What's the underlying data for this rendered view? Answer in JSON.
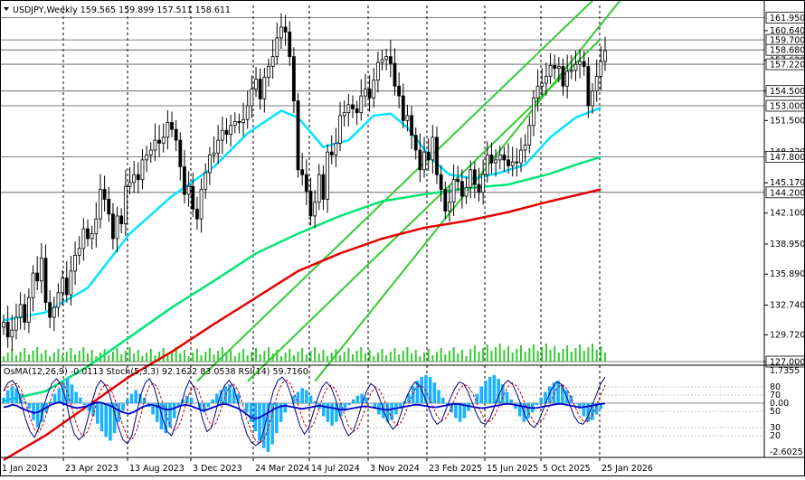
{
  "header": {
    "symbol_line": "USDJPY,Weekly  159.565 159.899 157.511 158.611"
  },
  "colors": {
    "candle": "#000000",
    "ma_fast": "#00e5ff",
    "ma_mid": "#00e676",
    "ma_slow": "#e60000",
    "channel": "#33cc33",
    "hist": "#1ab2ff",
    "stoch_main": "#000080",
    "stoch_signal": "#cc0000",
    "rsi": "#0000cc",
    "grid": "#000000"
  },
  "chart_data": [
    {
      "type": "candlestick",
      "title": "USDJPY,Weekly",
      "ohlc_last": {
        "open": 159.565,
        "high": 159.899,
        "low": 157.511,
        "close": 158.611
      },
      "ylim": [
        127.0,
        163.2
      ],
      "y_ticks": [
        160.64,
        157.62,
        154.5,
        151.5,
        148.32,
        145.17,
        142.1,
        138.95,
        135.89,
        132.74,
        129.72,
        127.0
      ],
      "x_ticks": [
        "1 Jan 2023",
        "23 Apr 2023",
        "13 Aug 2023",
        "3 Dec 2023",
        "24 Mar 2024",
        "14 Jul 2024",
        "3 Nov 2024",
        "23 Feb 2025",
        "15 Jun 2025",
        "5 Oct 2025",
        "25 Jan 2026"
      ],
      "price_levels": [
        {
          "value": 161.95,
          "label": "161.950"
        },
        {
          "value": 159.7,
          "label": "159.700"
        },
        {
          "value": 158.68,
          "label": "158.680"
        },
        {
          "value": 157.22,
          "label": "157.220"
        },
        {
          "value": 154.5,
          "label": "154.500"
        },
        {
          "value": 153.0,
          "label": "153.000"
        },
        {
          "value": 147.8,
          "label": "147.800"
        },
        {
          "value": 144.2,
          "label": "144.200"
        },
        {
          "value": 127.0,
          "label": "127.000"
        }
      ],
      "candles_close": [
        131.0,
        129.5,
        130.2,
        131.5,
        132.8,
        131.0,
        133.5,
        136.0,
        135.2,
        137.5,
        133.0,
        131.5,
        132.5,
        134.0,
        135.5,
        133.8,
        136.2,
        137.8,
        138.5,
        140.5,
        139.5,
        140.0,
        141.5,
        144.5,
        143.5,
        142.0,
        139.5,
        141.8,
        141.0,
        144.8,
        145.2,
        146.0,
        145.5,
        147.5,
        148.0,
        148.5,
        149.5,
        149.2,
        149.8,
        151.3,
        150.6,
        149.5,
        146.8,
        144.0,
        144.8,
        142.5,
        141.5,
        144.5,
        146.2,
        148.0,
        148.2,
        149.5,
        150.5,
        150.1,
        151.0,
        151.4,
        151.3,
        151.6,
        153.0,
        154.7,
        155.7,
        153.7,
        155.9,
        157.0,
        158.0,
        159.9,
        161.0,
        160.5,
        158.0,
        153.5,
        146.5,
        146.0,
        144.3,
        141.8,
        143.2,
        146.0,
        143.5,
        148.3,
        148.0,
        149.2,
        152.0,
        152.3,
        153.1,
        152.7,
        152.3,
        154.0,
        154.7,
        153.8,
        155.6,
        157.4,
        157.7,
        158.0,
        157.3,
        155.0,
        154.0,
        151.5,
        152.0,
        150.0,
        148.5,
        146.5,
        148.3,
        147.5,
        149.8,
        146.0,
        144.5,
        142.3,
        143.2,
        145.5,
        145.3,
        143.8,
        144.7,
        146.5,
        145.0,
        144.2,
        146.0,
        148.0,
        147.2,
        147.5,
        148.0,
        147.5,
        146.9,
        147.3,
        147.2,
        148.5,
        149.0,
        151.0,
        153.8,
        155.0,
        155.3,
        156.0,
        157.1,
        156.8,
        157.0,
        155.0,
        156.5,
        156.6,
        157.2,
        157.5,
        157.0,
        153.0,
        154.5,
        156.0,
        157.5,
        158.6
      ],
      "ma_fast": {
        "label": "",
        "points": [
          [
            0,
            131.2
          ],
          [
            10,
            132.0
          ],
          [
            20,
            134.5
          ],
          [
            30,
            140.0
          ],
          [
            40,
            143.8
          ],
          [
            50,
            146.8
          ],
          [
            58,
            150.2
          ],
          [
            66,
            152.5
          ],
          [
            70,
            151.8
          ],
          [
            76,
            148.8
          ],
          [
            82,
            149.5
          ],
          [
            88,
            152.0
          ],
          [
            92,
            152.2
          ],
          [
            96,
            150.8
          ],
          [
            102,
            147.5
          ],
          [
            106,
            146.0
          ],
          [
            112,
            145.6
          ],
          [
            118,
            146.2
          ],
          [
            124,
            147.0
          ],
          [
            130,
            149.8
          ],
          [
            136,
            151.8
          ],
          [
            142,
            152.8
          ]
        ]
      },
      "ma_mid": {
        "label": "",
        "points": [
          [
            0,
            123.0
          ],
          [
            10,
            124.0
          ],
          [
            20,
            126.5
          ],
          [
            30,
            129.5
          ],
          [
            40,
            132.5
          ],
          [
            50,
            135.2
          ],
          [
            60,
            138.0
          ],
          [
            70,
            140.0
          ],
          [
            80,
            141.8
          ],
          [
            90,
            143.3
          ],
          [
            100,
            144.0
          ],
          [
            110,
            144.6
          ],
          [
            120,
            145.0
          ],
          [
            130,
            146.1
          ],
          [
            136,
            147.0
          ],
          [
            142,
            147.8
          ]
        ]
      },
      "ma_slow": {
        "label": "",
        "points": [
          [
            0,
            117.0
          ],
          [
            10,
            119.5
          ],
          [
            20,
            122.5
          ],
          [
            30,
            125.5
          ],
          [
            40,
            128.0
          ],
          [
            50,
            130.8
          ],
          [
            60,
            133.5
          ],
          [
            70,
            136.2
          ],
          [
            80,
            138.0
          ],
          [
            90,
            139.5
          ],
          [
            100,
            140.6
          ],
          [
            110,
            141.3
          ],
          [
            120,
            142.2
          ],
          [
            130,
            143.3
          ],
          [
            136,
            143.9
          ],
          [
            142,
            144.5
          ]
        ]
      },
      "channel_lines": [
        {
          "points": [
            [
              46,
              125.0
            ],
            [
              142,
              164.5
            ]
          ]
        },
        {
          "points": [
            [
              58,
              125.0
            ],
            [
              142,
              159.8
            ]
          ]
        },
        {
          "points": [
            [
              74,
              125.0
            ],
            [
              149,
              165.0
            ]
          ]
        }
      ]
    },
    {
      "type": "oscillator",
      "title": "OsMA(12,26,9) -0.0113  Stoch(5,3,3) 92.1622 83.0538  RSI(14) 59.7160",
      "y_labels": [
        "1.7355",
        "80",
        "70",
        "0.00",
        "50",
        "30",
        "20",
        "-2.6025"
      ],
      "osma": [
        0.3,
        0.7,
        0.9,
        0.8,
        0.5,
        0.1,
        -0.3,
        -0.9,
        -1.3,
        -1.0,
        -0.5,
        0.1,
        0.5,
        0.8,
        1.1,
        1.3,
        1.0,
        0.6,
        0.3,
        -0.1,
        -0.4,
        -0.7,
        -1.1,
        -1.5,
        -1.8,
        -2.0,
        -1.6,
        -1.0,
        -0.4,
        0.2,
        0.5,
        0.7,
        0.5,
        0.3,
        -0.2,
        -0.6,
        -1.0,
        -1.4,
        -1.6,
        -1.3,
        -0.8,
        -0.2,
        0.2,
        0.4,
        0.3,
        0.0,
        -0.3,
        -0.5,
        -0.2,
        0.2,
        0.5,
        0.7,
        0.9,
        1.0,
        0.8,
        0.5,
        0.0,
        -0.5,
        -1.0,
        -1.5,
        -2.0,
        -2.4,
        -2.6,
        -2.2,
        -1.6,
        -1.0,
        -0.5,
        0.0,
        0.4,
        0.6,
        0.8,
        0.7,
        0.4,
        0.1,
        -0.3,
        -0.7,
        -1.0,
        -1.2,
        -1.0,
        -0.7,
        -0.4,
        -0.1,
        0.2,
        0.4,
        0.5,
        0.3,
        0.0,
        -0.3,
        -0.6,
        -0.8,
        -1.0,
        -0.9,
        -0.6,
        -0.3,
        0.1,
        0.5,
        0.9,
        1.2,
        1.4,
        1.5,
        1.4,
        1.1,
        0.7,
        0.3,
        -0.1,
        -0.5,
        -0.8,
        -1.0,
        -0.8,
        -0.4,
        0.0,
        0.5,
        0.9,
        1.2,
        1.4,
        1.5,
        1.3,
        1.0,
        0.6,
        0.2,
        -0.3,
        -0.7,
        -1.0,
        -0.8,
        -0.5,
        -0.1,
        0.3,
        0.6,
        0.9,
        1.1,
        1.2,
        1.0,
        0.7,
        0.4,
        0.0,
        -0.3,
        -0.7,
        -1.0,
        -0.9,
        -0.6,
        -0.3,
        -0.01
      ],
      "stoch_main": [
        75,
        85,
        88,
        80,
        60,
        40,
        25,
        18,
        30,
        55,
        72,
        85,
        90,
        82,
        66,
        40,
        22,
        15,
        20,
        40,
        62,
        80,
        88,
        82,
        70,
        50,
        30,
        15,
        10,
        20,
        45,
        70,
        85,
        90,
        80,
        60,
        40,
        25,
        20,
        35,
        55,
        75,
        88,
        80,
        62,
        40,
        25,
        30,
        50,
        70,
        82,
        88,
        80,
        60,
        40,
        22,
        12,
        8,
        12,
        30,
        55,
        75,
        88,
        92,
        85,
        70,
        50,
        32,
        22,
        30,
        48,
        66,
        80,
        86,
        80,
        66,
        46,
        30,
        20,
        25,
        40,
        58,
        74,
        84,
        80,
        66,
        50,
        36,
        28,
        34,
        50,
        66,
        78,
        86,
        82,
        70,
        56,
        42,
        34,
        38,
        52,
        66,
        78,
        86,
        84,
        74,
        60,
        46,
        36,
        34,
        42,
        56,
        70,
        82,
        88,
        84,
        72,
        58,
        44,
        34,
        30,
        38,
        52,
        66,
        78,
        86,
        84,
        72,
        58,
        44,
        36,
        34,
        42,
        56,
        70,
        84,
        92
      ],
      "rsi": [
        55,
        56,
        58,
        57,
        54,
        52,
        50,
        48,
        49,
        52,
        55,
        58,
        60,
        61,
        59,
        57,
        55,
        54,
        55,
        56,
        58,
        60,
        61,
        60,
        58,
        56,
        53,
        50,
        48,
        47,
        49,
        52,
        55,
        57,
        58,
        57,
        55,
        53,
        52,
        53,
        55,
        57,
        58,
        57,
        55,
        53,
        51,
        52,
        54,
        56,
        58,
        59,
        58,
        56,
        54,
        51,
        47,
        43,
        41,
        42,
        45,
        48,
        51,
        54,
        56,
        57,
        56,
        55,
        54,
        53,
        54,
        55,
        56,
        57,
        56,
        55,
        54,
        53,
        52,
        52,
        53,
        54,
        55,
        56,
        56,
        55,
        54,
        53,
        52,
        52,
        53,
        54,
        55,
        56,
        57,
        58,
        58,
        57,
        56,
        55,
        55,
        56,
        57,
        58,
        59,
        59,
        58,
        57,
        56,
        55,
        54,
        54,
        55,
        56,
        57,
        58,
        59,
        59,
        58,
        57,
        56,
        55,
        54,
        54,
        55,
        56,
        57,
        58,
        59,
        59,
        58,
        57,
        56,
        55,
        55,
        56,
        57,
        58,
        59,
        59.716
      ]
    }
  ]
}
